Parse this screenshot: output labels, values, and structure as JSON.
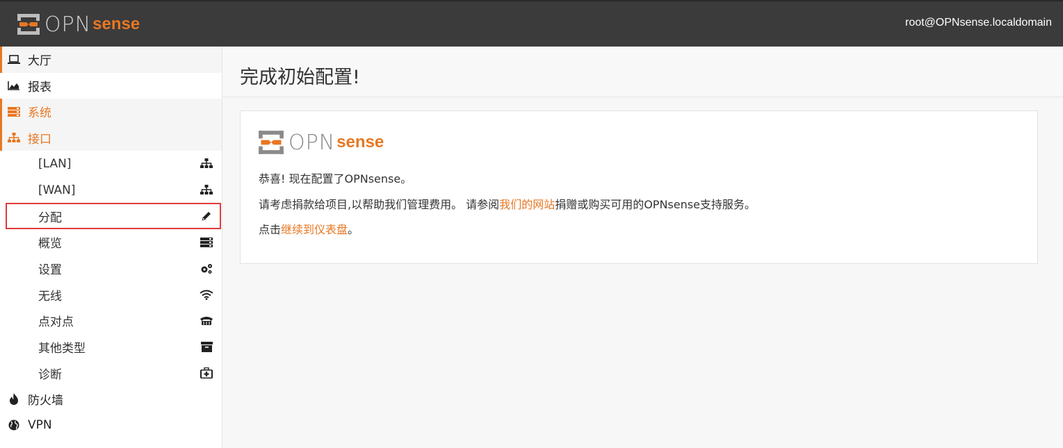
{
  "header": {
    "logo_main": "OPN",
    "logo_accent": "sense",
    "user": "root@OPNsense.localdomain"
  },
  "sidebar": {
    "items": [
      {
        "label": "大厅",
        "icon": "laptop-icon"
      },
      {
        "label": "报表",
        "icon": "area-chart-icon"
      },
      {
        "label": "系统",
        "icon": "server-icon"
      },
      {
        "label": "接口",
        "icon": "sitemap-icon"
      }
    ],
    "sub_items": [
      {
        "label": "[LAN]",
        "icon": "sitemap-icon"
      },
      {
        "label": "[WAN]",
        "icon": "sitemap-icon"
      },
      {
        "label": "分配",
        "icon": "pencil-icon"
      },
      {
        "label": "概览",
        "icon": "server-icon"
      },
      {
        "label": "设置",
        "icon": "gears-icon"
      },
      {
        "label": "无线",
        "icon": "wifi-icon"
      },
      {
        "label": "点对点",
        "icon": "phone-icon"
      },
      {
        "label": "其他类型",
        "icon": "archive-icon"
      },
      {
        "label": "诊断",
        "icon": "medkit-icon"
      }
    ],
    "after_items": [
      {
        "label": "防火墙",
        "icon": "fire-icon"
      },
      {
        "label": "VPN",
        "icon": "globe-icon"
      }
    ]
  },
  "main": {
    "title": "完成初始配置!",
    "congrats": "恭喜! 现在配置了OPNsense。",
    "donate_prefix": "请考虑捐款给项目,以帮助我们管理费用。 请参阅",
    "donate_link": "我们的网站",
    "donate_suffix": "捐赠或购买可用的OPNsense支持服务。",
    "continue_prefix": "点击",
    "continue_link": "继续到仪表盘",
    "continue_suffix": "。"
  },
  "colors": {
    "accent": "#e87722",
    "topbar": "#3b3b3b",
    "highlight": "#e03b3b"
  }
}
